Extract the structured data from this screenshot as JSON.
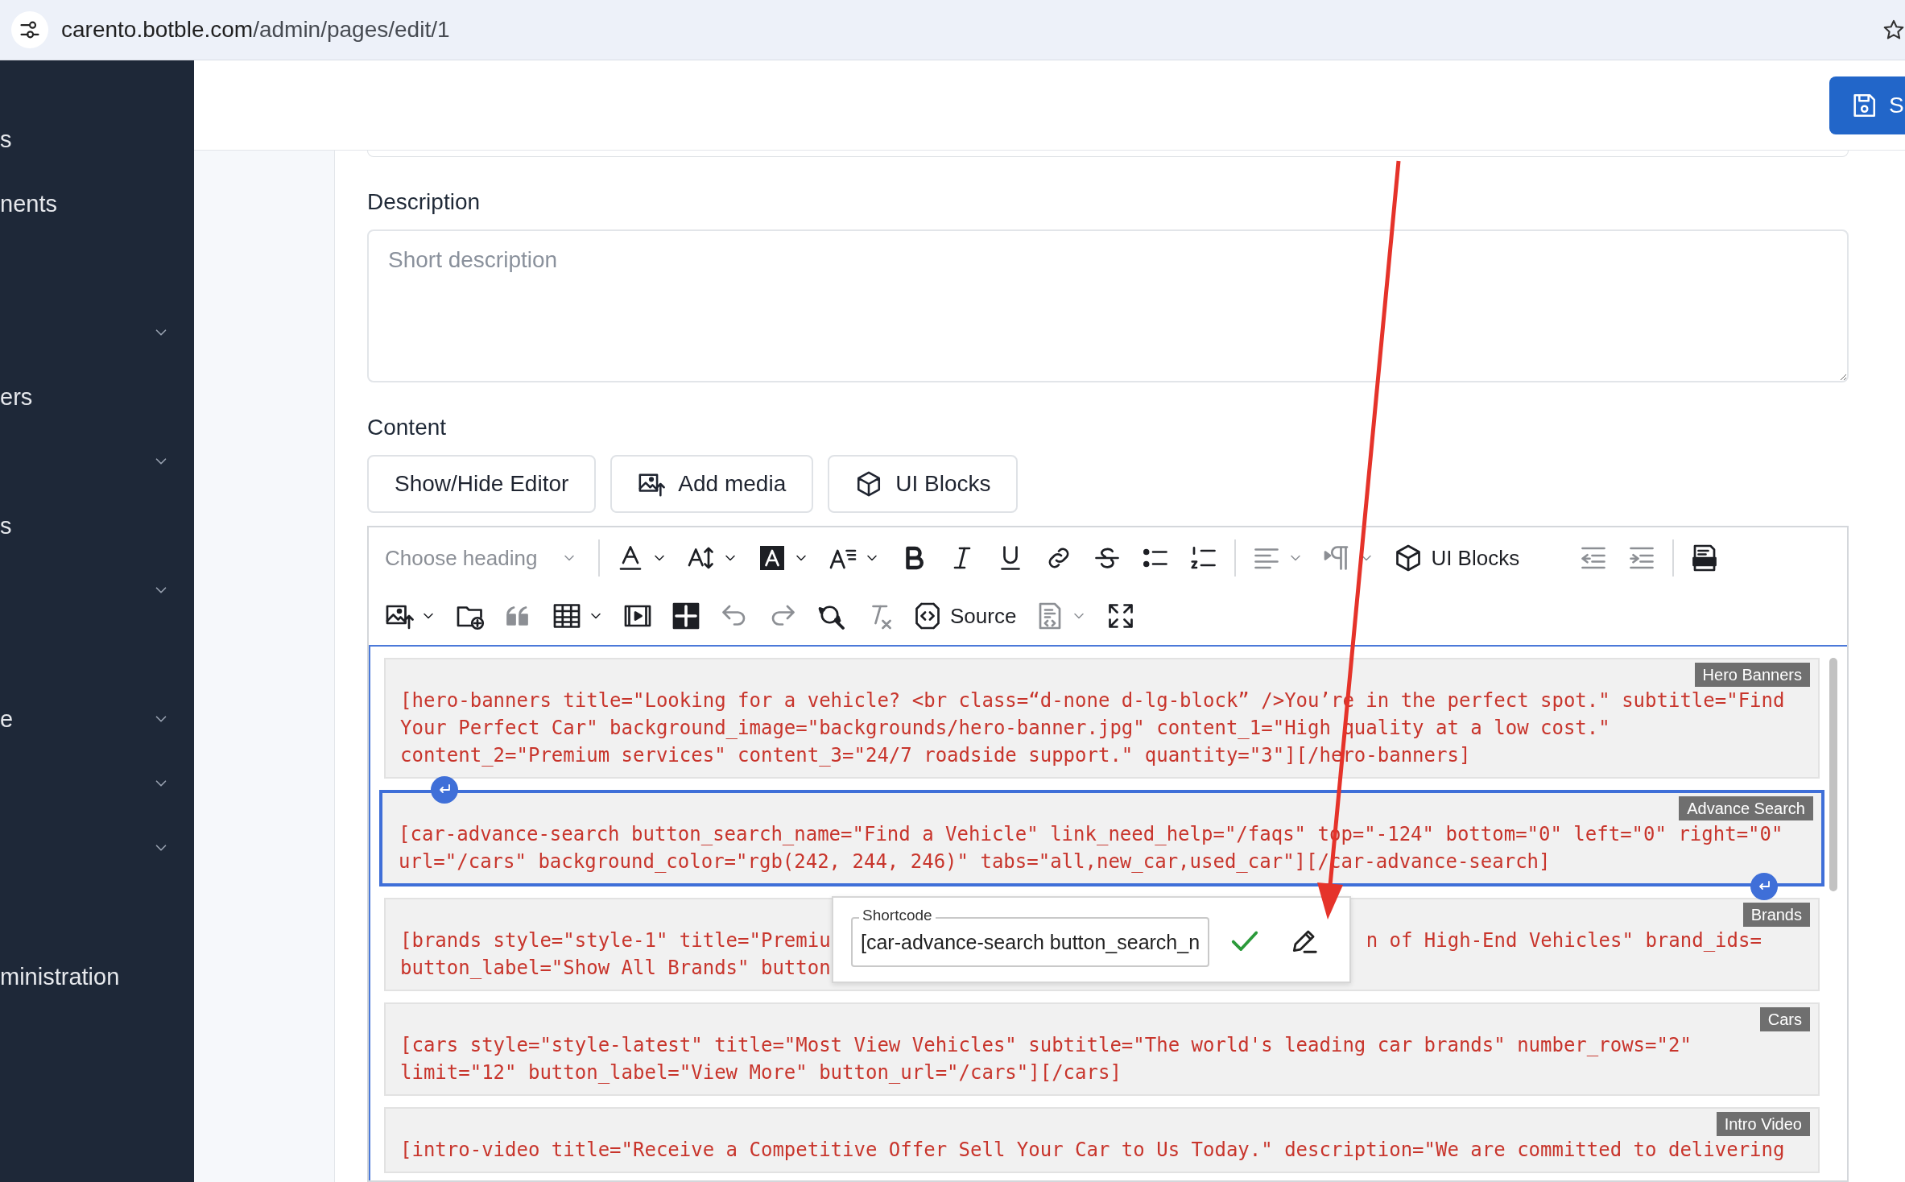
{
  "browser": {
    "url_host": "carento.botble.com",
    "url_path": "/admin/pages/edit/1"
  },
  "sidebar": {
    "items": [
      {
        "label": "s"
      },
      {
        "label": "nents"
      },
      {
        "expanded": false
      },
      {
        "label": "ers"
      },
      {
        "expanded": false
      },
      {
        "label": "s"
      },
      {
        "expanded": false
      },
      {
        "label": "e",
        "expanded": false
      },
      {
        "expanded": false
      },
      {
        "expanded": false
      },
      {
        "label": "ministration"
      }
    ]
  },
  "header": {
    "save_label": "S"
  },
  "form": {
    "description": {
      "label": "Description",
      "placeholder": "Short description"
    },
    "content": {
      "label": "Content",
      "buttons": [
        {
          "label": "Show/Hide Editor",
          "kind": "plain"
        },
        {
          "label": "Add media",
          "kind": "media"
        },
        {
          "label": "UI Blocks",
          "kind": "blocks"
        }
      ]
    }
  },
  "editor": {
    "toolbar": {
      "heading_placeholder": "Choose heading",
      "ui_blocks_label": "UI Blocks",
      "source_label": "Source"
    },
    "blocks": [
      {
        "label": "Hero Banners",
        "selected": false,
        "lines": [
          [
            "[hero-banners title=\"Looking for a vehicle? <br class=“d-none d-lg-block” />You’re in the perfect spot.\" subtitle=\"Find"
          ],
          [
            "Your Perfect Car\" background_image=\"backgrounds/hero-banner.jpg\" content_1=\"High quality at a low cost.\""
          ],
          [
            "content_2=\"Premium services\" content_3=\"24/7 roadside support.\" quantity=\"3\"][/hero-banners]"
          ]
        ]
      },
      {
        "label": "Advance Search",
        "selected": true,
        "lines": [
          [
            "[car-advance-search button_search_name=\"Find a Vehicle\" link_need_help=\"/faqs\" top=\"-124\" bottom=\"0\" left=\"0\" right=\"0\""
          ],
          [
            "url=\"/cars\" background_color=\"rgb(242, 244, 246)\" tabs=\"all,new_car,used_car\"][/car-advance-search]"
          ]
        ]
      },
      {
        "label": "Brands",
        "selected": false,
        "lines": [
          [
            "[brands style=\"style-1\" title=\"Premiu",
            "n of High-End Vehicles\" brand_ids="
          ],
          [
            "button_label=\"Show All Brands\" button"
          ]
        ]
      },
      {
        "label": "Cars",
        "selected": false,
        "lines": [
          [
            "[cars style=\"style-latest\" title=\"Most View Vehicles\" subtitle=\"The world's leading car brands\" number_rows=\"2\""
          ],
          [
            "limit=\"12\" button_label=\"View More\" button_url=\"/cars\"][/cars]"
          ]
        ]
      },
      {
        "label": "Intro Video",
        "selected": false,
        "lines": [
          [
            "[intro-video title=\"Receive a Competitive Offer Sell Your Car to Us Today.\" description=\"We are committed to delivering"
          ]
        ]
      }
    ],
    "popup": {
      "legend": "Shortcode",
      "value": "[car-advance-search button_search_n"
    }
  }
}
